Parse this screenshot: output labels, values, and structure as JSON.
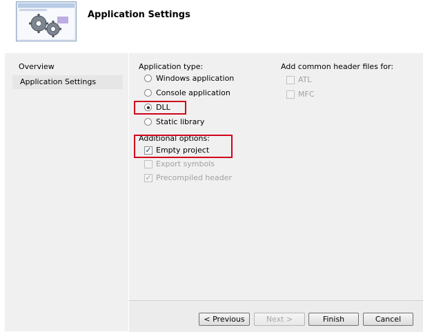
{
  "header": {
    "title": "Application Settings",
    "icon": "gears-window-icon"
  },
  "nav": {
    "items": [
      {
        "label": "Overview"
      },
      {
        "label": "Application Settings"
      }
    ]
  },
  "app_type": {
    "label": "Application type:",
    "options": [
      {
        "label": "Windows application",
        "selected": false
      },
      {
        "label": "Console application",
        "selected": false
      },
      {
        "label": "DLL",
        "selected": true
      },
      {
        "label": "Static library",
        "selected": false
      }
    ]
  },
  "additional": {
    "label": "Additional options:",
    "options": [
      {
        "label": "Empty project",
        "checked": true,
        "enabled": true
      },
      {
        "label": "Export symbols",
        "checked": false,
        "enabled": false
      },
      {
        "label": "Precompiled header",
        "checked": true,
        "enabled": false
      }
    ]
  },
  "common_headers": {
    "label": "Add common header files for:",
    "options": [
      {
        "label": "ATL",
        "checked": false,
        "enabled": false
      },
      {
        "label": "MFC",
        "checked": false,
        "enabled": false
      }
    ]
  },
  "buttons": {
    "previous": "< Previous",
    "next": "Next >",
    "finish": "Finish",
    "cancel": "Cancel"
  },
  "highlight_color": "#d0021b"
}
